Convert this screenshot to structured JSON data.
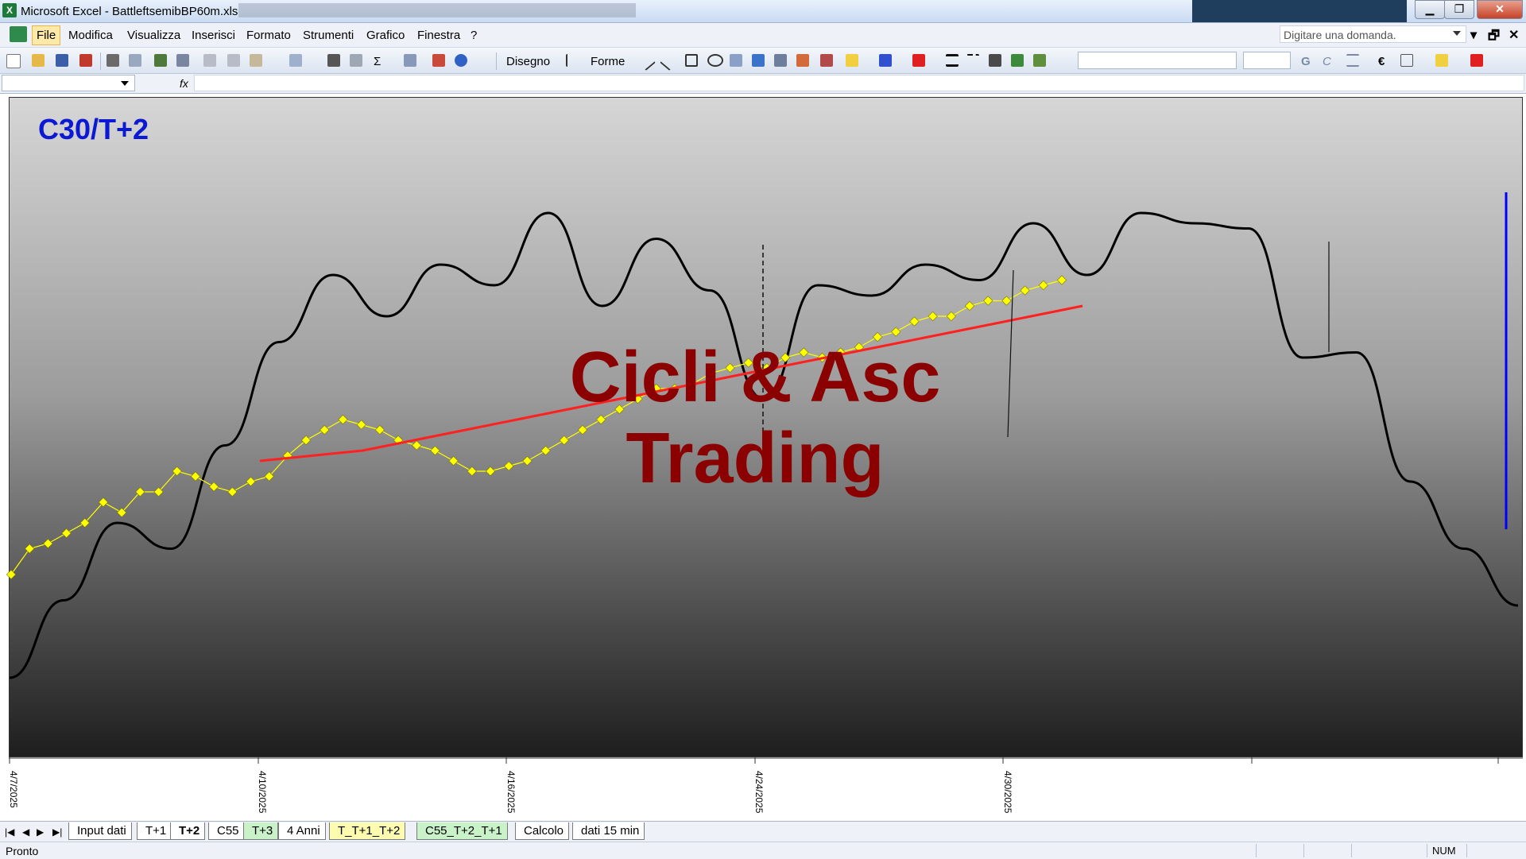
{
  "window": {
    "title": "Microsoft Excel - BattleftsemibBP60m.xls",
    "minimize": "▁",
    "maximize": "❐",
    "close": "✕"
  },
  "menu": {
    "items": [
      "File",
      "Modifica",
      "Visualizza",
      "Inserisci",
      "Formato",
      "Strumenti",
      "Grafico",
      "Finestra",
      "?"
    ],
    "ask_placeholder": "Digitare una domanda.",
    "mdi_minimize": "▾",
    "mdi_restore": "🗗",
    "mdi_close": "✕"
  },
  "toolbar": {
    "drawing_label": "Disegno",
    "shapes_label": "Forme",
    "bold": "G",
    "italic": "C",
    "euro": "€",
    "sigma": "Σ"
  },
  "formula_bar": {
    "fx": "fx"
  },
  "chart": {
    "title": "C30/T+2",
    "watermark_line1": "Cicli & Asc",
    "watermark_line2": "Trading",
    "x_tick_labels": [
      "4/7/2025",
      "4/10/2025",
      "4/16/2025",
      "4/24/2025",
      "4/30/2025"
    ],
    "colors": {
      "price": "#ffff00",
      "trend": "#ff2020",
      "cycle": "#000000",
      "marker": "#0000ff",
      "title": "#0b18d4",
      "watermark": "#8b0000"
    }
  },
  "chart_data": {
    "type": "line",
    "title": "C30/T+2",
    "x_tick_labels": [
      "4/7/2025",
      "4/10/2025",
      "4/16/2025",
      "4/24/2025",
      "4/30/2025"
    ],
    "y_axis_labels": "none shown",
    "grid": false,
    "legend": "none",
    "series": [
      {
        "values": [
          0.3,
          0.35,
          0.36,
          0.38,
          0.4,
          0.44,
          0.42,
          0.46,
          0.46,
          0.5,
          0.49,
          0.47,
          0.46,
          0.48,
          0.49,
          0.53,
          0.56,
          0.58,
          0.6,
          0.59,
          0.58,
          0.56,
          0.55,
          0.54,
          0.52,
          0.5,
          0.5,
          0.51,
          0.52,
          0.54,
          0.56,
          0.58,
          0.6,
          0.62,
          0.64,
          0.66,
          0.66,
          0.67,
          0.69,
          0.7,
          0.71,
          0.7,
          0.72,
          0.73,
          0.72,
          0.73,
          0.74,
          0.76,
          0.77,
          0.79,
          0.8,
          0.8,
          0.82,
          0.83,
          0.83,
          0.85,
          0.86,
          0.87
        ]
      },
      {
        "values": [
          0.52,
          0.53,
          0.54,
          0.56,
          0.58,
          0.6,
          0.62,
          0.64,
          0.66,
          0.68,
          0.7,
          0.72,
          0.74,
          0.76,
          0.78,
          0.8,
          0.82
        ]
      },
      {
        "values": [
          0.1,
          0.25,
          0.4,
          0.35,
          0.55,
          0.75,
          0.88,
          0.8,
          0.9,
          0.86,
          1.0,
          0.82,
          0.95,
          0.85,
          0.64,
          0.86,
          0.84,
          0.9,
          0.87,
          0.98,
          0.88,
          1.0,
          0.98,
          0.97,
          0.72,
          0.73,
          0.48,
          0.35,
          0.24
        ]
      }
    ]
  },
  "sheets": {
    "tabs": [
      "Input dati",
      "T+1",
      "T+2",
      "C55",
      "T+3",
      "4 Anni",
      "T_T+1_T+2",
      "C55_T+2_T+1",
      "Calcolo",
      "dati 15 min"
    ],
    "active": "T+2"
  },
  "status": {
    "left": "Pronto",
    "num": "NUM"
  }
}
